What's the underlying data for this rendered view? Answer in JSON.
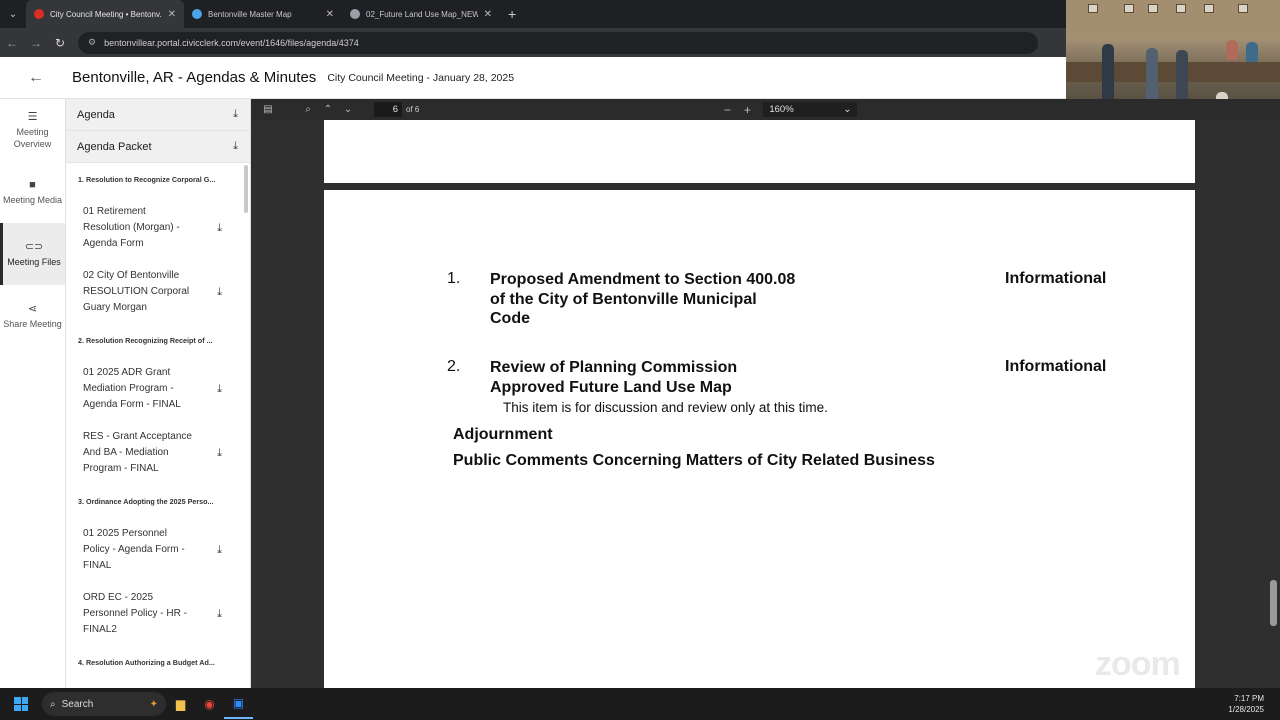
{
  "browser": {
    "tabs": [
      {
        "title": "City Council Meeting • Bentonv...",
        "favicon_color": "#d93025",
        "active": true
      },
      {
        "title": "Bentonville Master Map",
        "favicon_color": "#4ba3e8",
        "active": false
      },
      {
        "title": "02_Future Land Use Map_NEW",
        "favicon_color": "#9aa0a6",
        "active": false
      }
    ],
    "url": "bentonvillear.portal.civicclerk.com/event/1646/files/agenda/4374"
  },
  "header": {
    "org_title": "Bentonville, AR - Agendas & Minutes",
    "meeting_title": "City Council Meeting - January 28, 2025"
  },
  "rail": [
    {
      "label": "Meeting Overview",
      "icon": "list-icon"
    },
    {
      "label": "Meeting Media",
      "icon": "video-icon"
    },
    {
      "label": "Meeting Files",
      "icon": "paperclip-icon",
      "active": true
    },
    {
      "label": "Share Meeting",
      "icon": "share-icon"
    }
  ],
  "files": {
    "agenda_label": "Agenda",
    "packet_label": "Agenda Packet",
    "groups": [
      {
        "section": "1. Resolution to Recognize Corporal G...",
        "items": [
          "01 Retirement Resolution (Morgan) - Agenda Form",
          "02 City Of Bentonville RESOLUTION Corporal Guary Morgan"
        ]
      },
      {
        "section": "2. Resolution Recognizing Receipt of ...",
        "items": [
          "01 2025 ADR Grant Mediation Program - Agenda Form - FINAL",
          "RES - Grant Acceptance And BA - Mediation Program - FINAL"
        ]
      },
      {
        "section": "3. Ordinance Adopting the 2025 Perso...",
        "items": [
          "01 2025 Personnel Policy - Agenda Form - FINAL",
          "ORD EC - 2025 Personnel Policy - HR - FINAL2"
        ]
      },
      {
        "section": "4. Resolution Authorizing a Budget Ad...",
        "items": []
      }
    ]
  },
  "pdf": {
    "page_current": "6",
    "page_total": "of 6",
    "zoom": "160%",
    "content": {
      "item1_number": "1.",
      "item1_lines": [
        "Proposed Amendment to Section 400.08",
        "of the City of Bentonville Municipal",
        "Code"
      ],
      "item1_status": "Informational",
      "item2_number": "2.",
      "item2_lines": [
        "Review of Planning Commission",
        "Approved Future Land Use Map"
      ],
      "item2_status": "Informational",
      "item2_note": "This item is for discussion and review only at this time.",
      "adjournment": "Adjournment",
      "public_comments": "Public Comments Concerning Matters of City Related Business"
    }
  },
  "taskbar": {
    "search_label": "Search",
    "time": "7:17 PM",
    "date": "1/28/2025"
  },
  "watermark_text": "zoom"
}
